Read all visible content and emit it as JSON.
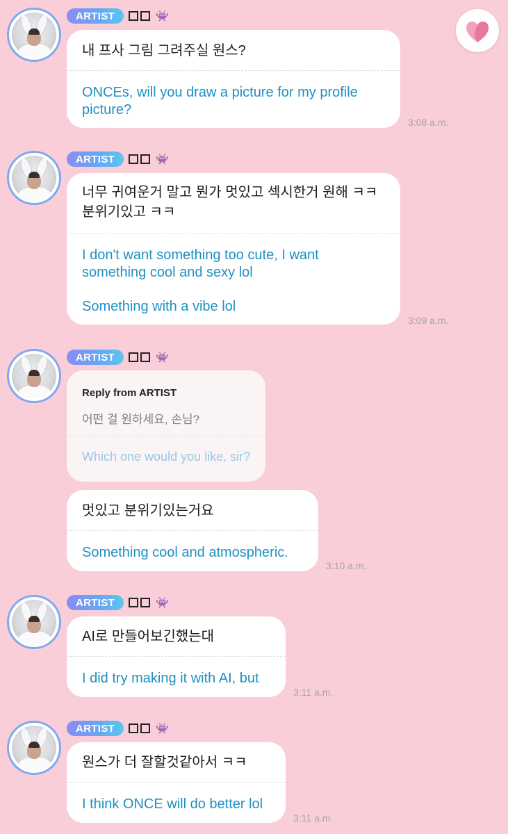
{
  "header": {
    "like_icon": "heart-icon"
  },
  "badge": {
    "artist_label": "ARTIST",
    "icon": "alien-monster-icon"
  },
  "messages": [
    {
      "ko": "내 프사 그림 그려주실 원스?",
      "en": [
        "ONCEs, will you draw a picture for my profile",
        "picture?"
      ],
      "time": "3:08 a.m."
    },
    {
      "ko": [
        "너무 귀여운거 말고 뭔가 멋있고 섹시한거 원해 ㅋㅋ",
        "분위기있고 ㅋㅋ"
      ],
      "en": [
        "I don't want something too cute, I want",
        "something cool and sexy lol",
        "Something with a vibe lol"
      ],
      "time": "3:09 a.m."
    },
    {
      "reply": {
        "label": "Reply from ARTIST",
        "ko": "어떤 걸 원하세요, 손님?",
        "en": "Which one would you like, sir?"
      }
    },
    {
      "ko": "멋있고 분위기있는거요",
      "en": "Something cool and atmospheric.",
      "time": "3:10 a.m."
    },
    {
      "ko": "AI로 만들어보긴했는대",
      "en": "I did try making it with AI, but",
      "time": "3:11 a.m."
    },
    {
      "ko": "원스가 더 잘할것같아서 ㅋㅋ",
      "en": "I think ONCE will do better lol",
      "time": "3:11 a.m."
    }
  ]
}
